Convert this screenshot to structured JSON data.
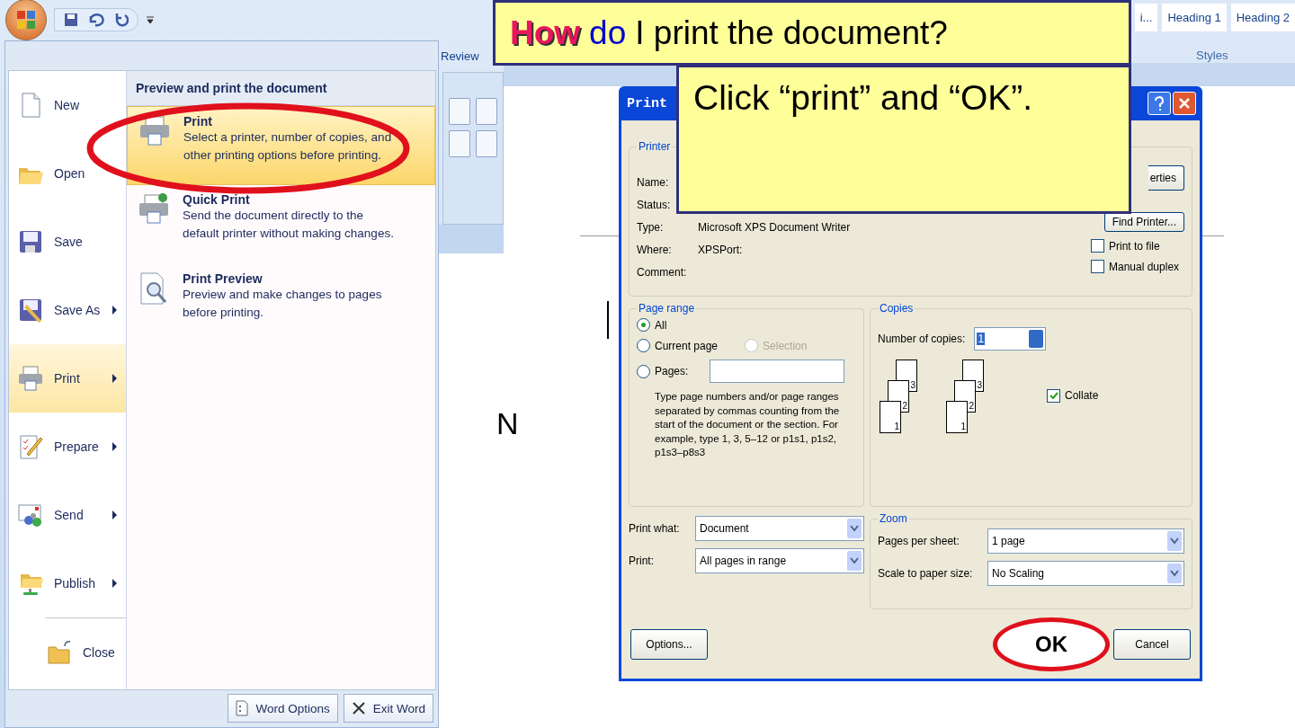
{
  "ribbon": {
    "tab": "Review",
    "styles": [
      "i...",
      "Heading 1",
      "Heading 2"
    ],
    "group_label": "Styles"
  },
  "office_menu": {
    "items": [
      {
        "label": "New",
        "submenu": false,
        "selected": false
      },
      {
        "label": "Open",
        "submenu": false,
        "selected": false
      },
      {
        "label": "Save",
        "submenu": false,
        "selected": false
      },
      {
        "label": "Save As",
        "submenu": true,
        "selected": false
      },
      {
        "label": "Print",
        "submenu": true,
        "selected": true
      },
      {
        "label": "Prepare",
        "submenu": true,
        "selected": false
      },
      {
        "label": "Send",
        "submenu": true,
        "selected": false
      },
      {
        "label": "Publish",
        "submenu": true,
        "selected": false
      },
      {
        "label": "Close",
        "submenu": false,
        "selected": false
      }
    ],
    "panel_title": "Preview and print the document",
    "options": [
      {
        "title": "Print",
        "description": "Select a printer, number of copies, and other printing options before printing.",
        "selected": true
      },
      {
        "title": "Quick Print",
        "description": "Send the document directly to the default printer without making changes.",
        "selected": false
      },
      {
        "title": "Print Preview",
        "description": "Preview and make changes to pages before printing.",
        "selected": false
      }
    ],
    "footer_buttons": [
      "Word Options",
      "Exit Word"
    ]
  },
  "document": {
    "text": "N"
  },
  "dialog": {
    "title": "Print",
    "printer": {
      "legend": "Printer",
      "fields": [
        {
          "label": "Name:"
        },
        {
          "label": "Status:"
        },
        {
          "label": "Type:",
          "value": "Microsoft XPS Document Writer"
        },
        {
          "label": "Where:",
          "value": "XPSPort:"
        },
        {
          "label": "Comment:"
        }
      ],
      "buttons": [
        "erties",
        "Find Printer..."
      ],
      "checks": [
        {
          "label": "Print to file",
          "checked": false
        },
        {
          "label": "Manual duplex",
          "checked": false
        }
      ]
    },
    "page_range": {
      "legend": "Page range",
      "options": [
        {
          "label": "All",
          "selected": true,
          "disabled": false
        },
        {
          "label": "Current page",
          "selected": false,
          "disabled": false
        },
        {
          "label": "Selection",
          "selected": false,
          "disabled": true
        },
        {
          "label": "Pages:",
          "selected": false,
          "disabled": false
        }
      ],
      "hint": "Type page numbers and/or page ranges separated by commas counting from the start of the document or the section. For example, type 1, 3, 5–12 or p1s1, p1s2, p1s3–p8s3"
    },
    "copies": {
      "legend": "Copies",
      "label": "Number of copies:",
      "value": "1",
      "stacks": [
        [
          "3",
          "2",
          "1"
        ],
        [
          "3",
          "2",
          "1"
        ]
      ],
      "collate": {
        "label": "Collate",
        "checked": true
      }
    },
    "print_what": {
      "label": "Print what:",
      "value": "Document"
    },
    "print": {
      "label": "Print:",
      "value": "All pages in range"
    },
    "zoom": {
      "legend": "Zoom",
      "fields": [
        {
          "label": "Pages per sheet:",
          "value": "1 page"
        },
        {
          "label": "Scale to paper size:",
          "value": "No Scaling"
        }
      ]
    },
    "buttons": [
      "Options...",
      "OK",
      "Cancel"
    ]
  },
  "callouts": {
    "question": [
      {
        "text": "How",
        "color": "#e8175d"
      },
      {
        "text": "do",
        "color": "#0000cc"
      },
      {
        "text": "I print the document?",
        "color": "#000000"
      }
    ],
    "answer": "Click “print” and “OK”."
  }
}
